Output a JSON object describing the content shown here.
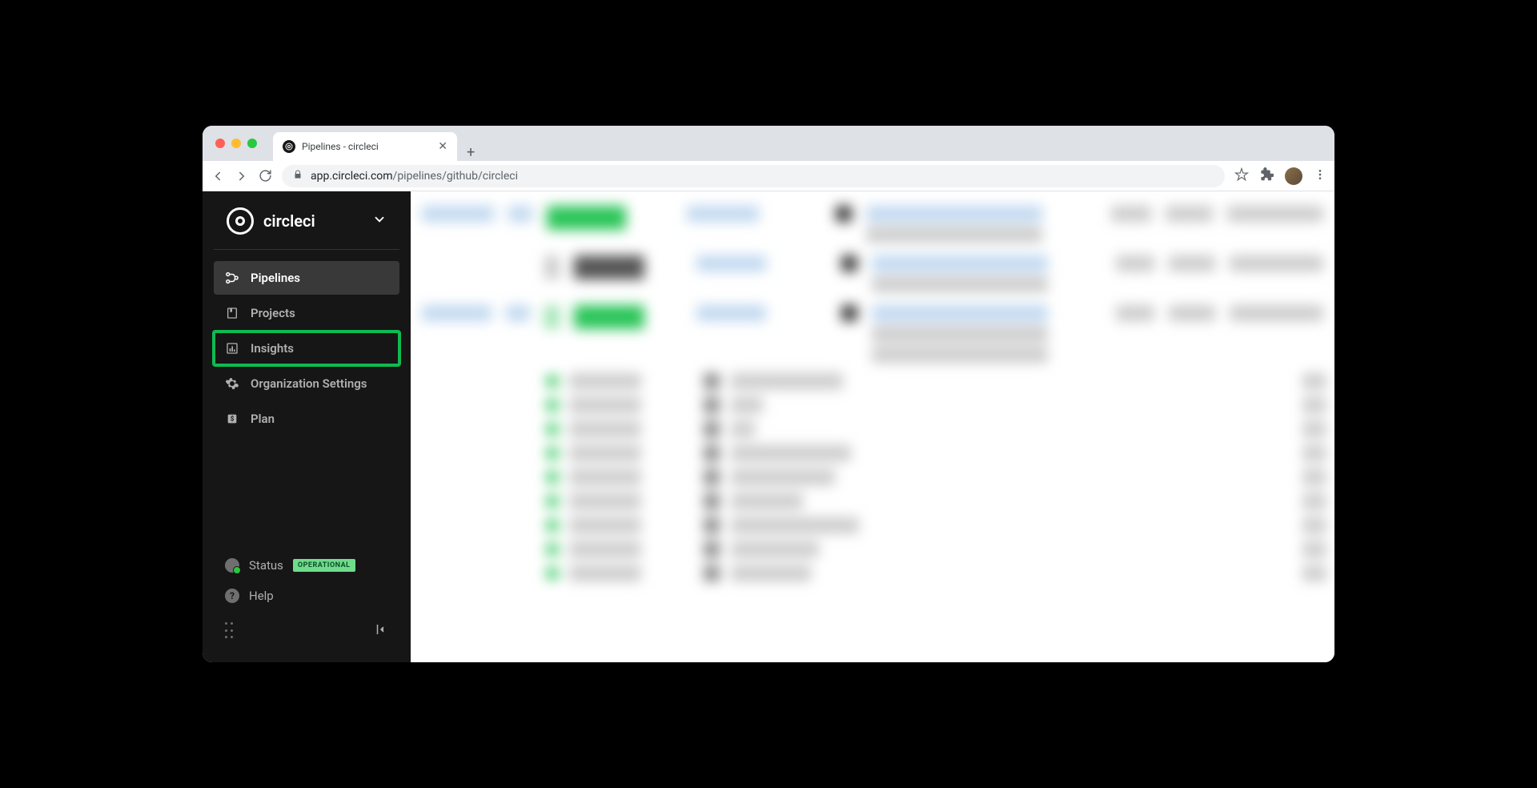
{
  "browser": {
    "tab_title": "Pipelines - circleci",
    "url_domain": "app.circleci.com",
    "url_path": "/pipelines/github/circleci"
  },
  "sidebar": {
    "org_name": "circleci",
    "nav": [
      {
        "label": "Pipelines",
        "active": true,
        "highlighted": false
      },
      {
        "label": "Projects",
        "active": false,
        "highlighted": false
      },
      {
        "label": "Insights",
        "active": false,
        "highlighted": true
      },
      {
        "label": "Organization Settings",
        "active": false,
        "highlighted": false
      },
      {
        "label": "Plan",
        "active": false,
        "highlighted": false
      }
    ],
    "status_label": "Status",
    "status_badge": "OPERATIONAL",
    "help_label": "Help"
  }
}
